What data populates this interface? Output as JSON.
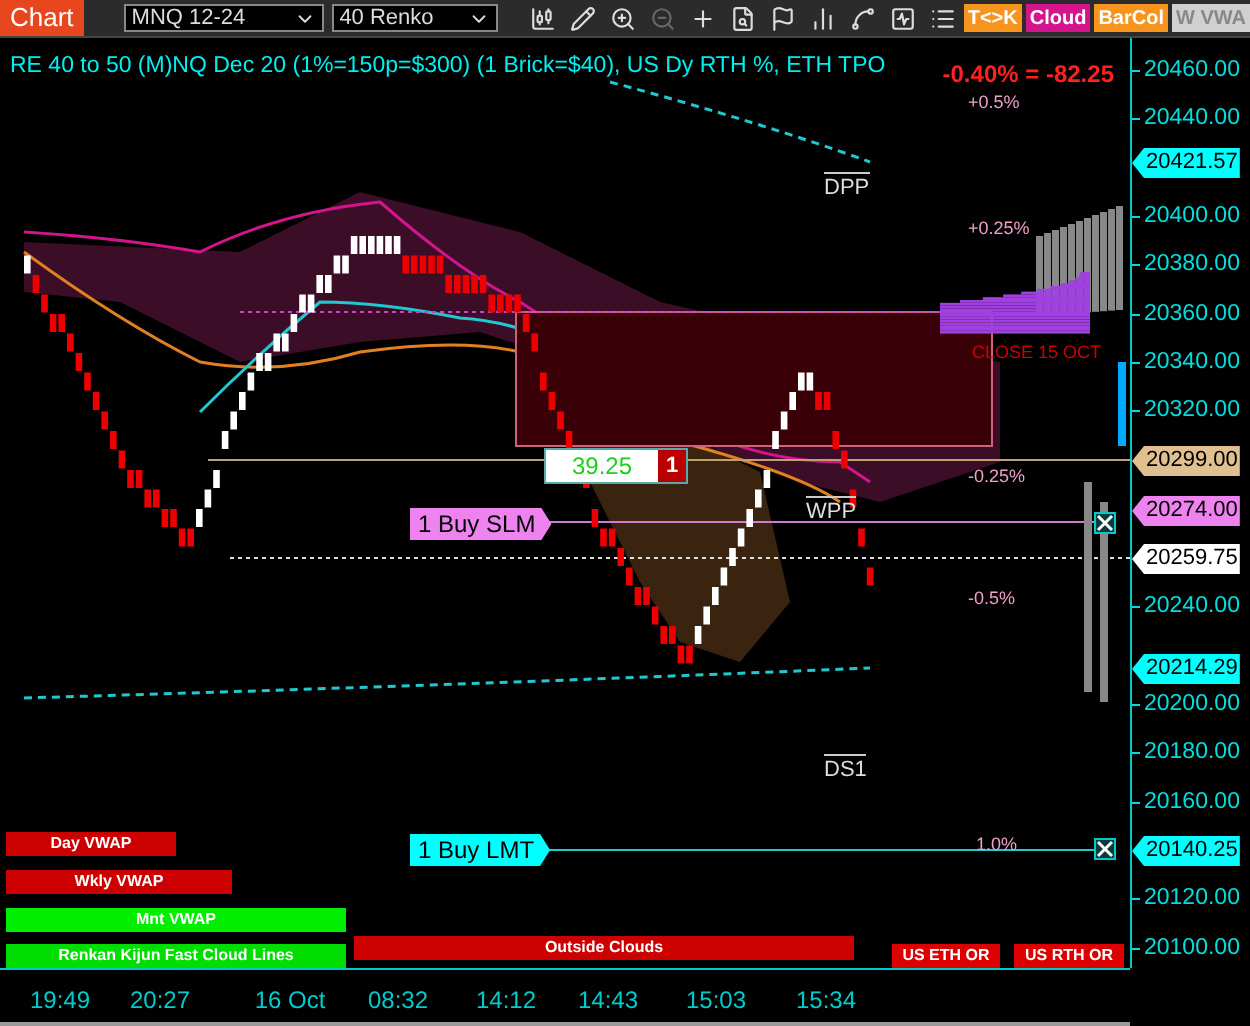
{
  "toolbar": {
    "app_label": "Chart",
    "instrument": "MNQ 12-24",
    "period": "40 Renko",
    "tools": [
      {
        "kind": "candles",
        "disabled": false
      },
      {
        "kind": "pencil",
        "disabled": false
      },
      {
        "kind": "zoom-in",
        "disabled": false
      },
      {
        "kind": "zoom-out",
        "disabled": true
      },
      {
        "kind": "crosshair",
        "disabled": false
      },
      {
        "kind": "doc-search",
        "disabled": false
      },
      {
        "kind": "flag",
        "disabled": false
      },
      {
        "kind": "bars",
        "disabled": false
      },
      {
        "kind": "spline",
        "disabled": false
      },
      {
        "kind": "activity",
        "disabled": false
      },
      {
        "kind": "list",
        "disabled": false
      }
    ],
    "toggle_buttons": [
      {
        "label": "T<>K",
        "color": "#f7941d"
      },
      {
        "label": "Cloud",
        "color": "#d4148c"
      },
      {
        "label": "BarCol",
        "color": "#f7941d"
      },
      {
        "label": "W VWA",
        "color": "#d0d0d0"
      }
    ]
  },
  "chart": {
    "title": "RE 40 to 50 (M)NQ Dec 20 (1%=150p=$300) (1 Brick=$40), US Dy RTH %, ETH TPO",
    "change": "-0.40% = -82.25",
    "percent_levels": [
      "+0.5%",
      "+0.25%",
      "-0.25%",
      "-0.5%",
      "1.0%"
    ],
    "close_label": "CLOSE 15 OCT",
    "pivots": [
      "DPP",
      "WPP",
      "DS1"
    ],
    "position": {
      "pnl": "39.25",
      "quantity": "1"
    },
    "orders": [
      {
        "label": "1 Buy SLM",
        "color": "#ee82ee"
      },
      {
        "label": "1 Buy LMT",
        "color": "#00ffff"
      }
    ],
    "indicator_bars": [
      {
        "label": "Day VWAP",
        "color": "#cc0000"
      },
      {
        "label": "Wkly VWAP",
        "color": "#cc0000"
      },
      {
        "label": "Mnt VWAP",
        "color": "#00ee00"
      },
      {
        "label": "Renkan Kijun Fast Cloud Lines",
        "color": "#00dd00"
      },
      {
        "label": "Outside Clouds",
        "color": "#cc0000"
      },
      {
        "label": "US ETH OR",
        "color": "#dd0000"
      },
      {
        "label": "US RTH OR",
        "color": "#dd0000"
      }
    ]
  },
  "price_axis": {
    "ticks": [
      "20460.00",
      "20440.00",
      "20400.00",
      "20380.00",
      "20360.00",
      "20340.00",
      "20320.00",
      "20240.00",
      "20200.00",
      "20180.00",
      "20160.00",
      "20120.00",
      "20100.00"
    ],
    "tags": [
      {
        "label": "20421.57",
        "color": "#00ffff"
      },
      {
        "label": "20299.00",
        "color": "#e0c090"
      },
      {
        "label": "20274.00",
        "color": "#ee82ee"
      },
      {
        "label": "20259.75",
        "color": "#ffffff"
      },
      {
        "label": "20214.29",
        "color": "#00ffff"
      },
      {
        "label": "20140.25",
        "color": "#00ffff"
      }
    ]
  },
  "time_axis": {
    "labels": [
      "19:49",
      "20:27",
      "16 Oct",
      "08:32",
      "14:12",
      "14:43",
      "15:03",
      "15:34"
    ]
  }
}
